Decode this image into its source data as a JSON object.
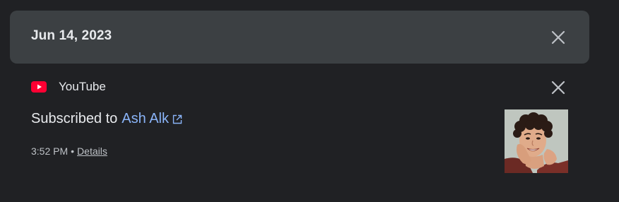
{
  "date_card": {
    "date": "Jun 14, 2023"
  },
  "activity": {
    "product": "YouTube",
    "action": "Subscribed to",
    "channel": "Ash Alk",
    "time": "3:52 PM",
    "separator": "•",
    "details_label": "Details"
  },
  "colors": {
    "background": "#202124",
    "card": "#3c4043",
    "link": "#8ab4f8",
    "youtube_red": "#ff0033"
  },
  "icons": {
    "product": "youtube-icon",
    "close": "close-icon",
    "external": "open-in-new-icon"
  }
}
